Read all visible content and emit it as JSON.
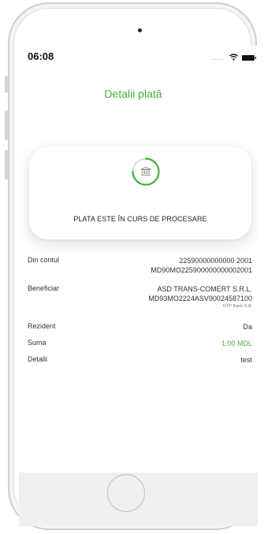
{
  "status_bar": {
    "time": "06:08",
    "signal": "....."
  },
  "header": {
    "title": "Detalii plată"
  },
  "status_card": {
    "icon": "bank-icon",
    "message": "PLATA ESTE ÎN CURS DE PROCESARE",
    "progress_fraction": 0.75
  },
  "details": {
    "from_account": {
      "label": "Din contul",
      "line1": "22590000000000 2001",
      "line2": "MD90MO225900000000002001"
    },
    "beneficiary": {
      "label": "Beneficiar",
      "name": "ASD TRANS-COMERT S.R.L.",
      "iban": "MD93MO2224ASV90024587100",
      "bank": "OTP Bank S.A."
    },
    "resident": {
      "label": "Rezident",
      "value": "Da"
    },
    "amount": {
      "label": "Suma",
      "value": "1.00 MDL"
    },
    "details_field": {
      "label": "Detalii",
      "value": "test"
    }
  },
  "colors": {
    "accent": "#4aae3f",
    "text": "#333333",
    "bottom_bar": "#efeff1"
  }
}
